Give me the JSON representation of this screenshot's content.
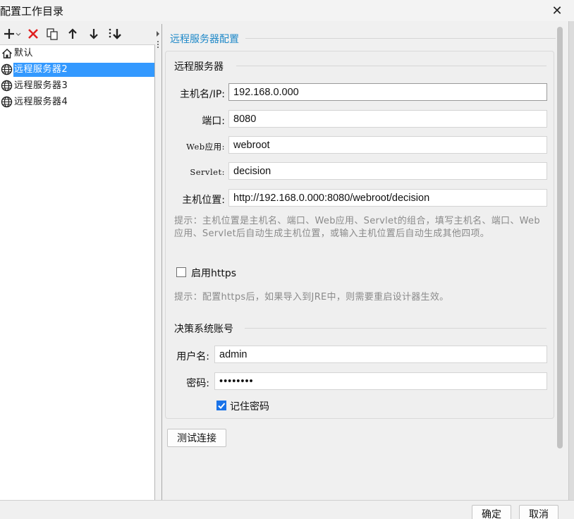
{
  "window": {
    "title": "配置工作目录",
    "close_glyph": "✕"
  },
  "toolbar": {
    "add_icon": "plus-icon",
    "delete_icon": "delete-icon",
    "copy_icon": "copy-icon",
    "up_icon": "arrow-up-icon",
    "down_icon": "arrow-down-icon",
    "sort_icon": "sort-icon"
  },
  "tree": {
    "items": [
      {
        "label": "默认",
        "icon": "home-icon",
        "selected": false
      },
      {
        "label": "远程服务器2",
        "icon": "globe-icon",
        "selected": true
      },
      {
        "label": "远程服务器3",
        "icon": "globe-icon",
        "selected": false
      },
      {
        "label": "远程服务器4",
        "icon": "globe-icon",
        "selected": false
      }
    ]
  },
  "panel": {
    "title": "远程服务器配置",
    "server_section": "远程服务器",
    "host_label": "主机名/IP:",
    "host_value": "192.168.0.000",
    "port_label": "端口:",
    "port_value": "8080",
    "webapp_label": "Web应用:",
    "webapp_value": "webroot",
    "servlet_label": "Servlet:",
    "servlet_value": "decision",
    "location_label": "主机位置:",
    "location_value": "http://192.168.0.000:8080/webroot/decision",
    "hint1": "提示：主机位置是主机名、端口、Web应用、Servlet的组合，填写主机名、端口、Web应用、Servlet后自动生成主机位置，或输入主机位置后自动生成其他四项。",
    "https_label": "启用https",
    "https_checked": false,
    "hint2": "提示：配置https后，如果导入到JRE中，则需要重启设计器生效。",
    "account_section": "决策系统账号",
    "user_label": "用户名:",
    "user_value": "admin",
    "pwd_label": "密码:",
    "pwd_value": "••••••••",
    "remember_label": "记住密码",
    "remember_checked": true,
    "test_button": "测试连接"
  },
  "footer": {
    "ok": "确定",
    "cancel": "取消"
  },
  "colors": {
    "accent": "#1e88c8",
    "selection": "#3399ff",
    "delete": "#e02020",
    "checkbox": "#1a73e8"
  }
}
